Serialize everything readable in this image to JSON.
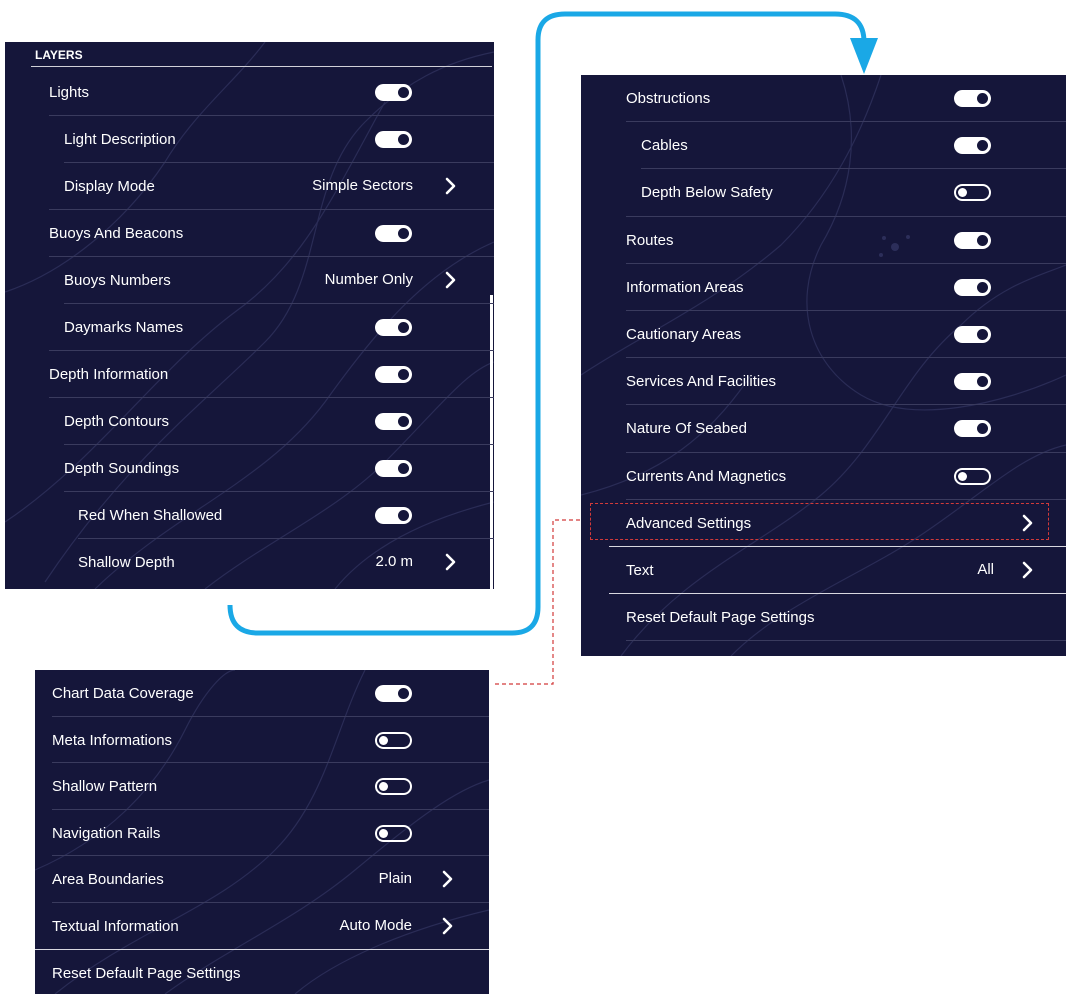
{
  "colors": {
    "panel_bg": "#15163a",
    "accent_arrow": "#1aa8e6",
    "highlight_dash": "#d23a3a"
  },
  "panel1": {
    "header": "LAYERS",
    "rows": [
      {
        "label": "Lights",
        "control": "toggle",
        "state": "on"
      },
      {
        "label": "Light Description",
        "control": "toggle",
        "state": "on"
      },
      {
        "label": "Display Mode",
        "control": "value",
        "value": "Simple Sectors"
      },
      {
        "label": "Buoys And Beacons",
        "control": "toggle",
        "state": "on"
      },
      {
        "label": "Buoys Numbers",
        "control": "value",
        "value": "Number Only"
      },
      {
        "label": "Daymarks Names",
        "control": "toggle",
        "state": "on"
      },
      {
        "label": "Depth Information",
        "control": "toggle",
        "state": "on"
      },
      {
        "label": "Depth Contours",
        "control": "toggle",
        "state": "on"
      },
      {
        "label": "Depth Soundings",
        "control": "toggle",
        "state": "on"
      },
      {
        "label": "Red When Shallowed",
        "control": "toggle",
        "state": "on"
      },
      {
        "label": "Shallow Depth",
        "control": "value",
        "value": "2.0 m"
      }
    ]
  },
  "panel2": {
    "rows": [
      {
        "label": "Obstructions",
        "control": "toggle",
        "state": "on"
      },
      {
        "label": "Cables",
        "control": "toggle",
        "state": "on"
      },
      {
        "label": "Depth Below Safety",
        "control": "toggle",
        "state": "off"
      },
      {
        "label": "Routes",
        "control": "toggle",
        "state": "on"
      },
      {
        "label": "Information Areas",
        "control": "toggle",
        "state": "on"
      },
      {
        "label": "Cautionary Areas",
        "control": "toggle",
        "state": "on"
      },
      {
        "label": "Services And Facilities",
        "control": "toggle",
        "state": "on"
      },
      {
        "label": "Nature Of Seabed",
        "control": "toggle",
        "state": "on"
      },
      {
        "label": "Currents And Magnetics",
        "control": "toggle",
        "state": "off"
      },
      {
        "label": "Advanced Settings",
        "control": "arrow"
      },
      {
        "label": "Text",
        "control": "value",
        "value": "All"
      },
      {
        "label": "Reset Default Page Settings",
        "control": "none"
      }
    ]
  },
  "panel3": {
    "rows": [
      {
        "label": "Chart Data Coverage",
        "control": "toggle",
        "state": "on"
      },
      {
        "label": "Meta Informations",
        "control": "toggle",
        "state": "off"
      },
      {
        "label": "Shallow Pattern",
        "control": "toggle",
        "state": "off"
      },
      {
        "label": "Navigation Rails",
        "control": "toggle",
        "state": "off"
      },
      {
        "label": "Area Boundaries",
        "control": "value",
        "value": "Plain"
      },
      {
        "label": "Textual Information",
        "control": "value",
        "value": "Auto Mode"
      },
      {
        "label": "Reset Default Page Settings",
        "control": "none"
      }
    ]
  }
}
